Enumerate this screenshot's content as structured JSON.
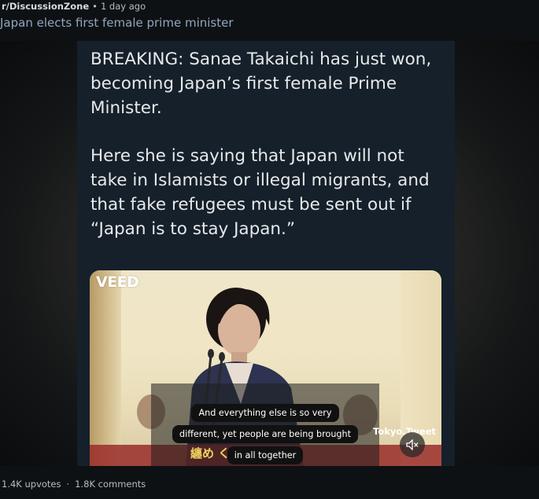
{
  "post": {
    "subreddit": "r/DiscussionZone",
    "separator": "•",
    "time": "1 day ago",
    "title": "Japan elects first female prime minister"
  },
  "tweet": {
    "paragraph1": "BREAKING: Sanae Takaichi has just won, becoming Japan’s first female Prime Minister.",
    "paragraph2": "Here she is saying that Japan will not take in Islamists or illegal migrants, and that  fake refugees must be sent out if “Japan is to stay Japan.”"
  },
  "video": {
    "logo": "VEED",
    "watermark": "Tokyo.Tweet",
    "caption_lines": [
      "And everything else is so very",
      "different, yet people are being brought",
      "in all together"
    ],
    "burned_japanese": "纏め  くと",
    "mute_icon": "speaker-muted-icon"
  },
  "stats": {
    "upvotes": "1.4K upvotes",
    "separator": "·",
    "comments": "1.8K comments"
  },
  "colors": {
    "page_bg": "#0e1113",
    "tweet_bg": "#15202b",
    "title": "#8fa6c0",
    "meta": "#b7bdc1"
  }
}
